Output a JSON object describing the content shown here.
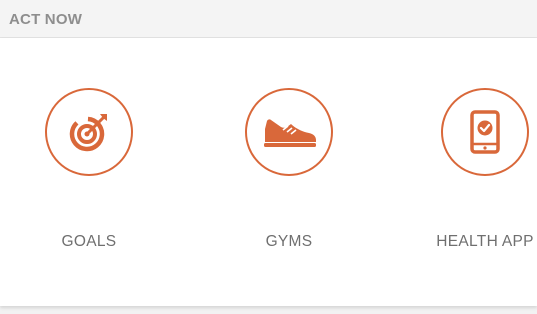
{
  "header": {
    "title": "ACT NOW"
  },
  "actions": [
    {
      "label": "GOALS",
      "icon": "target-icon"
    },
    {
      "label": "GYMS",
      "icon": "sneaker-icon"
    },
    {
      "label": "HEALTH APP",
      "icon": "smartphone-check-icon"
    }
  ],
  "colors": {
    "accent": "#d9683a",
    "label": "#6f6f6f",
    "header_text": "#8e8e8e",
    "background": "#f2f2f2"
  }
}
